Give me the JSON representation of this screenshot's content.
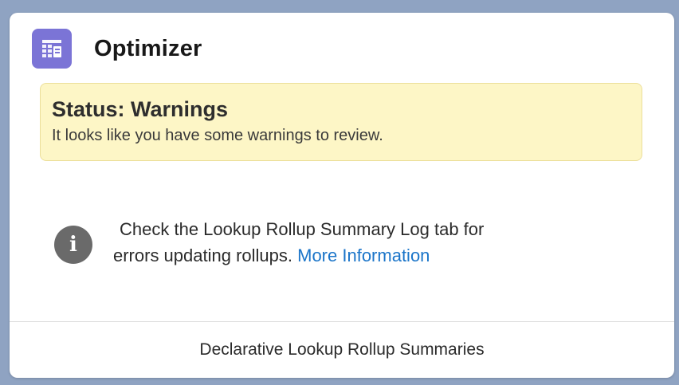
{
  "card": {
    "title": "Optimizer",
    "icon": "optimizer-app-icon"
  },
  "status": {
    "title": "Status: Warnings",
    "message": "It looks like you have some warnings to review."
  },
  "info": {
    "icon": "info-icon",
    "line1": "Check the Lookup Rollup Summary Log tab for",
    "line2": "errors updating rollups. ",
    "link_label": "More Information"
  },
  "footer": {
    "link_label": "Declarative Lookup Rollup Summaries"
  },
  "colors": {
    "icon_bg": "#7b74d6",
    "warning_bg": "#fdf6c6",
    "link": "#1b75c9"
  }
}
